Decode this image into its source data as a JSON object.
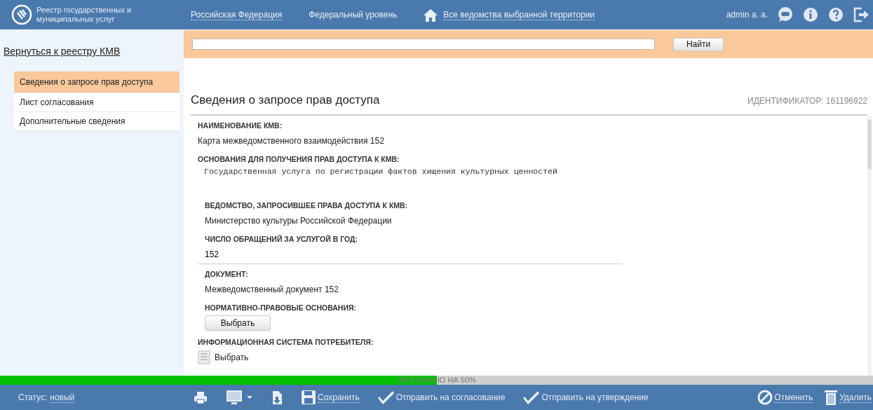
{
  "header": {
    "logo_text": "Реестр государственных и муниципальных услуг",
    "nav": [
      {
        "label": "Российская Федерация",
        "kind": "link"
      },
      {
        "label": "Федеральный уровень",
        "kind": "text"
      },
      {
        "label": "Все ведомства выбранной территории",
        "kind": "home-link"
      }
    ],
    "user": "admin a. a."
  },
  "sidebar": {
    "back_link": "Вернуться к реестру КМВ",
    "items": [
      {
        "label": "Сведения о запросе прав доступа",
        "selected": true
      },
      {
        "label": "Лист согласования",
        "selected": false
      },
      {
        "label": "Дополнительные сведения",
        "selected": false
      }
    ]
  },
  "search": {
    "button": "Найти"
  },
  "panel": {
    "title": "Сведения о запросе прав доступа",
    "identifier": "ИДЕНТИФИКАТОР: 161196922",
    "fields": [
      {
        "kind": "text",
        "label": "НАИМЕНОВАНИЕ КМВ:",
        "value": "Карта межведомственного взаимодействия 152"
      },
      {
        "kind": "mono",
        "label": "ОСНОВАНИЯ ДЛЯ ПОЛУЧЕНИЯ ПРАВ ДОСТУПА К КМВ:",
        "value": "Государственная услуга по регистрации фактов хищения культурных ценностей"
      },
      {
        "kind": "sub-text",
        "label": "ВЕДОМСТВО, ЗАПРОСИВШЕЕ ПРАВА ДОСТУПА К КМВ:",
        "value": "Министерство культуры Российской Федерации"
      },
      {
        "kind": "sub-input",
        "label": "ЧИСЛО ОБРАЩЕНИЙ ЗА УСЛУГОЙ В ГОД:",
        "value": "152"
      },
      {
        "kind": "sub-text",
        "label": "ДОКУМЕНТ:",
        "value": "Межведомственный документ 152"
      },
      {
        "kind": "sub-button",
        "label": "НОРМАТИВНО-ПРАВОВЫЕ ОСНОВАНИЯ:",
        "value": "Выбрать"
      },
      {
        "kind": "picker",
        "label": "ИНФОРМАЦИОННАЯ СИСТЕМА ПОТРЕБИТЕЛЯ:",
        "value": "Выбрать"
      }
    ]
  },
  "progress": {
    "level": 0.5,
    "label": "ЗАПОЛНЕНО НА 50%"
  },
  "toolbar": {
    "status_label": "Статус:",
    "status_value": "новый",
    "actions": [
      {
        "kind": "print"
      },
      {
        "kind": "display"
      },
      {
        "kind": "export"
      },
      {
        "kind": "save",
        "label": "Сохранить"
      },
      {
        "kind": "send",
        "label": "Отправить на согласование"
      },
      {
        "kind": "send",
        "label": "Отправить на утверждение"
      }
    ],
    "right_actions": [
      {
        "kind": "cancel",
        "label": "Отменить"
      },
      {
        "kind": "delete",
        "label": "Удалить"
      }
    ]
  }
}
